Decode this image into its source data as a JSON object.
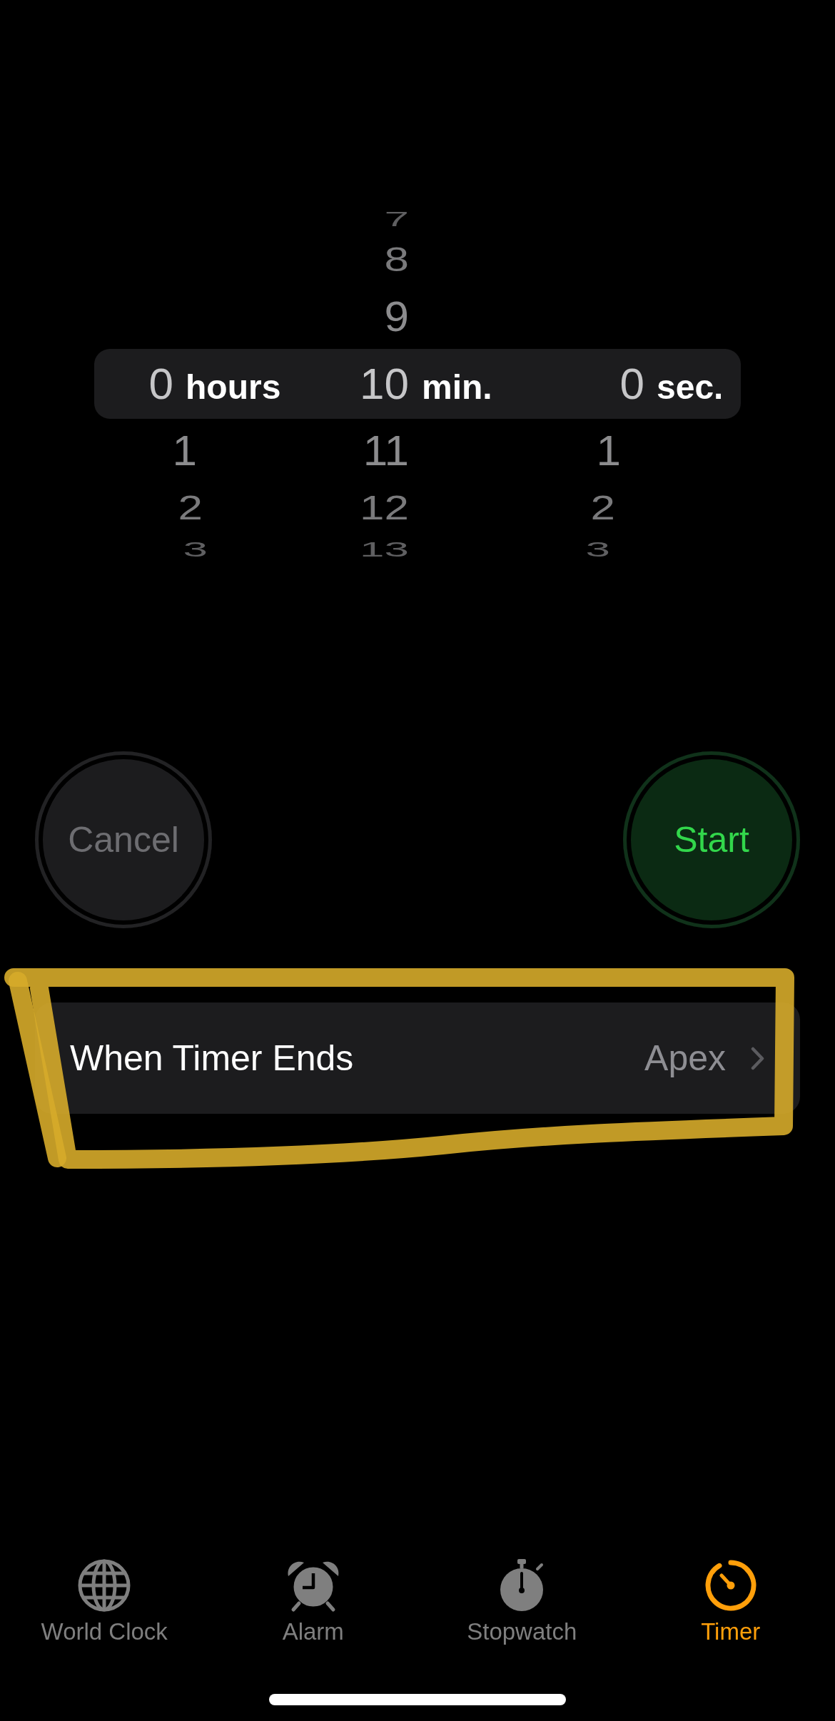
{
  "picker": {
    "columns": [
      {
        "unit": "hours",
        "values": [
          {
            "text": "0",
            "selected": true
          },
          {
            "text": "1",
            "selected": false
          },
          {
            "text": "2",
            "selected": false
          },
          {
            "text": "3",
            "selected": false
          }
        ]
      },
      {
        "unit": "min.",
        "values": [
          {
            "text": "7",
            "selected": false
          },
          {
            "text": "8",
            "selected": false
          },
          {
            "text": "9",
            "selected": false
          },
          {
            "text": "10",
            "selected": true
          },
          {
            "text": "11",
            "selected": false
          },
          {
            "text": "12",
            "selected": false
          },
          {
            "text": "13",
            "selected": false
          }
        ]
      },
      {
        "unit": "sec.",
        "values": [
          {
            "text": "0",
            "selected": true
          },
          {
            "text": "1",
            "selected": false
          },
          {
            "text": "2",
            "selected": false
          },
          {
            "text": "3",
            "selected": false
          }
        ]
      }
    ]
  },
  "buttons": [
    {
      "label": "Cancel",
      "kind": "cancel",
      "disabled": true
    },
    {
      "label": "Start",
      "kind": "start",
      "disabled": false
    }
  ],
  "timer_end": {
    "label": "When Timer Ends",
    "value": "Apex",
    "highlighted": true
  },
  "tab_bar": {
    "tabs": [
      {
        "label": "World Clock",
        "selected": false
      },
      {
        "label": "Alarm",
        "selected": false
      },
      {
        "label": "Stopwatch",
        "selected": false
      },
      {
        "label": "Timer",
        "selected": true
      }
    ]
  }
}
